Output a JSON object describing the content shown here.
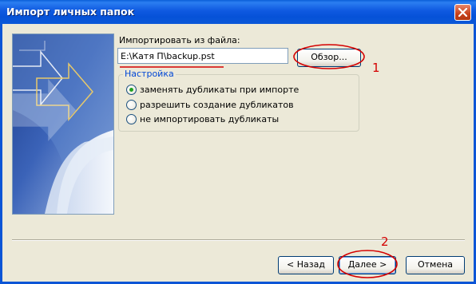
{
  "window": {
    "title": "Импорт личных папок"
  },
  "import": {
    "from_file_label": "Импортировать из файла:",
    "file_path_value": "E:\\Катя П\\backup.pst",
    "browse_label": "Обзор..."
  },
  "settings": {
    "legend": "Настройка",
    "options": [
      {
        "label": "заменять дубликаты при импорте",
        "selected": true
      },
      {
        "label": "разрешить создание дубликатов",
        "selected": false
      },
      {
        "label": "не импортировать дубликаты",
        "selected": false
      }
    ]
  },
  "footer": {
    "back_label": "< Назад",
    "next_label": "Далее >",
    "cancel_label": "Отмена"
  },
  "annotations": {
    "mark_1": "1",
    "mark_2": "2",
    "color": "#D40000"
  },
  "colors": {
    "titlebar": "#0A58D8",
    "dialog_bg": "#ECE9D8",
    "group_legend": "#0046D5",
    "radio_dot": "#21A121"
  }
}
